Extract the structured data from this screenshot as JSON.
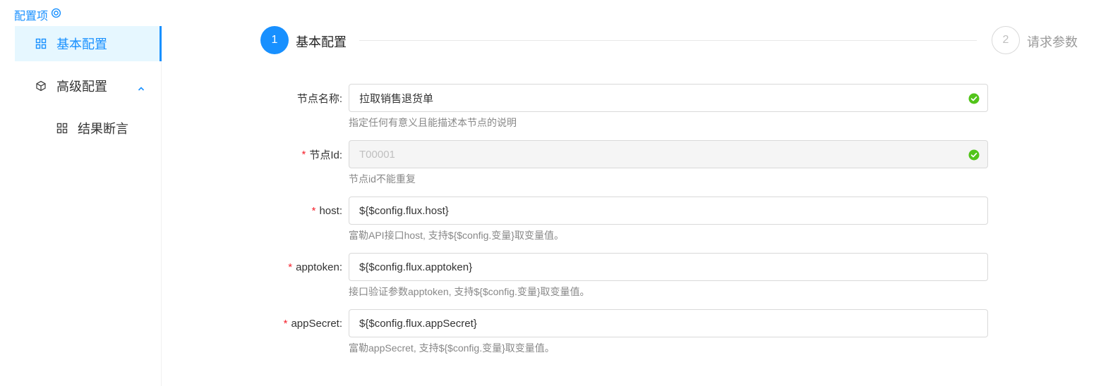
{
  "sidebar": {
    "title": "配置项",
    "items": [
      {
        "label": "基本配置",
        "icon": "appstore-icon",
        "selected": true
      },
      {
        "label": "高级配置",
        "icon": "cube-icon",
        "expanded": true
      },
      {
        "label": "结果断言",
        "icon": "appstore-icon"
      }
    ]
  },
  "steps": [
    {
      "number": "1",
      "label": "基本配置",
      "status": "active"
    },
    {
      "number": "2",
      "label": "请求参数",
      "status": "wait"
    }
  ],
  "form": {
    "fields": [
      {
        "label": "节点名称:",
        "required": false,
        "value": "拉取销售退货单",
        "help": "指定任何有意义且能描述本节点的说明",
        "valid": true,
        "disabled": false
      },
      {
        "label": "节点Id:",
        "required": true,
        "value": "T00001",
        "help": "节点id不能重复",
        "valid": true,
        "disabled": true
      },
      {
        "label": "host:",
        "required": true,
        "value": "${$config.flux.host}",
        "help": "富勒API接口host, 支持${$config.变量}取变量值。",
        "valid": false,
        "disabled": false
      },
      {
        "label": "apptoken:",
        "required": true,
        "value": "${$config.flux.apptoken}",
        "help": "接口验证参数apptoken, 支持${$config.变量}取变量值。",
        "valid": false,
        "disabled": false
      },
      {
        "label": "appSecret:",
        "required": true,
        "value": "${$config.flux.appSecret}",
        "help": "富勒appSecret, 支持${$config.变量}取变量值。",
        "valid": false,
        "disabled": false
      }
    ]
  },
  "colors": {
    "primary": "#1890ff",
    "success": "#52c41a",
    "required": "#f5222d"
  }
}
